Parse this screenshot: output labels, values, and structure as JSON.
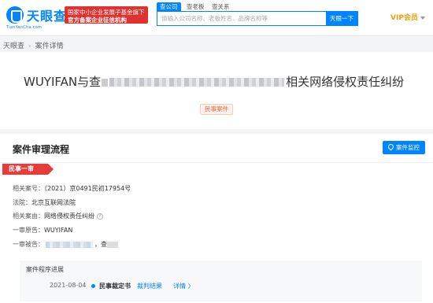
{
  "header": {
    "logo_text": "天眼查",
    "logo_sub": "TianYanCha.com",
    "promo_line1": "国家中小企业发展子基金旗下",
    "promo_line2": "官方备案企业征信机构",
    "tabs": [
      {
        "label": "查公司",
        "active": true
      },
      {
        "label": "查老板",
        "active": false
      },
      {
        "label": "查关系",
        "active": false
      }
    ],
    "search_placeholder": "请输入公司名称、老板姓名、品牌名称等",
    "search_button": "天眼一下",
    "vip_label": "VIP会员"
  },
  "breadcrumb": {
    "home": "天眼查",
    "current": "案件详情"
  },
  "case": {
    "title_prefix": "WUYIFAN与查",
    "title_suffix": "相关网络侵权责任纠纷",
    "tag": "民事案件"
  },
  "process": {
    "title": "案件审理流程",
    "monitor_button": "案件监控",
    "stage": "民事一审",
    "fields": {
      "case_no_label": "相关案号：",
      "case_no": "（2021）京0491民初17954号",
      "court_label": "法院：",
      "court": "北京互联网法院",
      "cause_label": "相关案由：",
      "cause": "网络侵权责任纠纷",
      "plaintiff_label": "一审原告：",
      "plaintiff": "WUYIFAN",
      "defendant_label": "一审被告：",
      "defendant_suffix": "，查"
    },
    "progress": {
      "title": "案件程序进展",
      "items": [
        {
          "date": "2021-08-04",
          "doc": "民事裁定书",
          "result_link": "裁判结果",
          "detail_link": "详情 〉"
        }
      ]
    }
  },
  "colors": {
    "brand": "#0084ff",
    "promo_red": "#e0312f",
    "stage_red": "#e53d3d",
    "vip_gold": "#f2a007"
  }
}
